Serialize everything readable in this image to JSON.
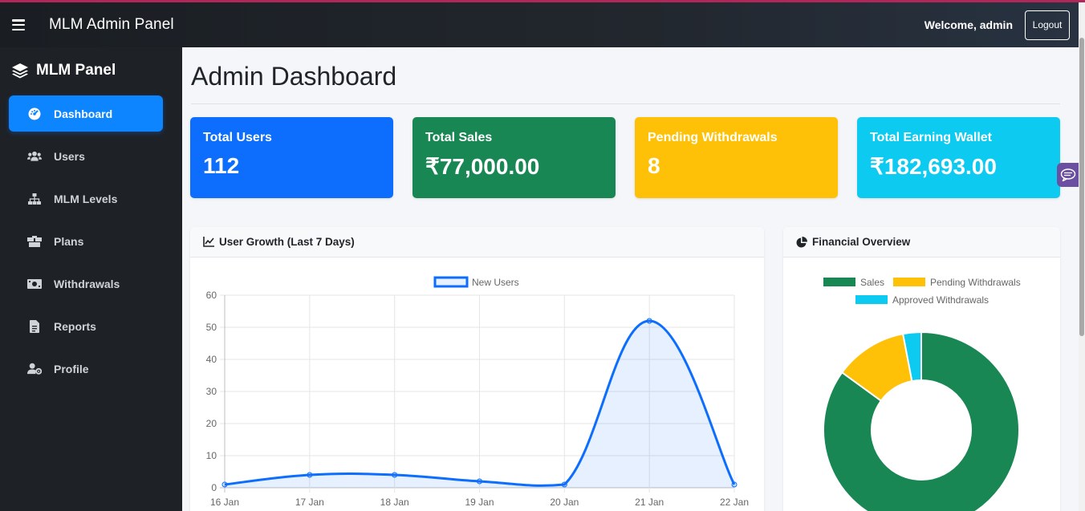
{
  "header": {
    "title": "MLM Admin Panel",
    "welcome": "Welcome, admin",
    "logout_label": "Logout"
  },
  "sidebar": {
    "brand": "MLM Panel",
    "items": [
      {
        "label": "Dashboard",
        "icon": "tachometer-icon",
        "active": true
      },
      {
        "label": "Users",
        "icon": "users-icon"
      },
      {
        "label": "MLM Levels",
        "icon": "sitemap-icon"
      },
      {
        "label": "Plans",
        "icon": "boxes-icon"
      },
      {
        "label": "Withdrawals",
        "icon": "money-bill-icon"
      },
      {
        "label": "Reports",
        "icon": "file-icon"
      },
      {
        "label": "Profile",
        "icon": "user-cog-icon"
      }
    ]
  },
  "page": {
    "title": "Admin Dashboard"
  },
  "cards": [
    {
      "label": "Total Users",
      "value": "112",
      "color": "#0d6efd"
    },
    {
      "label": "Total Sales",
      "value": "₹77,000.00",
      "color": "#198754"
    },
    {
      "label": "Pending Withdrawals",
      "value": "8",
      "color": "#ffc107"
    },
    {
      "label": "Total Earning Wallet",
      "value": "₹182,693.00",
      "color": "#0dcaf0"
    }
  ],
  "panels": {
    "growth_title": "User Growth (Last 7 Days)",
    "financial_title": "Financial Overview"
  },
  "chart_data": [
    {
      "type": "line",
      "categories": [
        "16 Jan",
        "17 Jan",
        "18 Jan",
        "19 Jan",
        "20 Jan",
        "21 Jan",
        "22 Jan"
      ],
      "series": [
        {
          "name": "New Users",
          "values": [
            1,
            4,
            4,
            2,
            1,
            52,
            1
          ],
          "color": "#0d6efd"
        }
      ],
      "yticks": [
        "0",
        "10",
        "20",
        "30",
        "40",
        "50",
        "60"
      ],
      "ylim": [
        0,
        60
      ],
      "grid": true,
      "legend": "top"
    },
    {
      "type": "pie",
      "labels": [
        "Sales",
        "Pending Withdrawals",
        "Approved Withdrawals"
      ],
      "values": [
        85,
        12,
        3
      ],
      "colors": [
        "#198754",
        "#ffc107",
        "#0dcaf0"
      ],
      "legend": "top"
    }
  ]
}
